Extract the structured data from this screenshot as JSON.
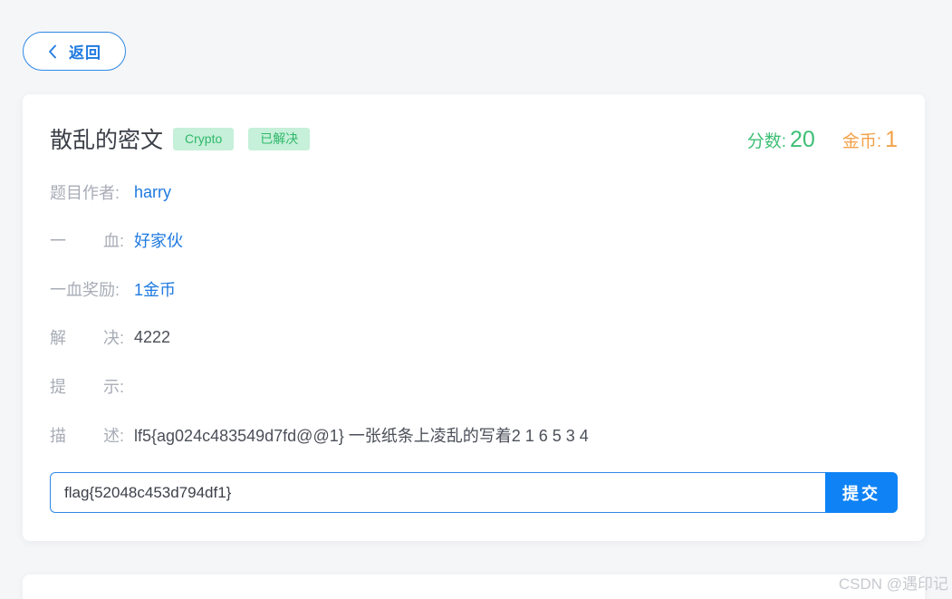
{
  "nav": {
    "back_label": "返回"
  },
  "challenge": {
    "title": "散乱的密文",
    "tags": [
      "Crypto",
      "已解决"
    ],
    "score_label": "分数:",
    "score_value": "20",
    "coin_label": "金币:",
    "coin_value": "1",
    "fields": {
      "author": {
        "label": "题目作者:",
        "value": "harry"
      },
      "first_blood": {
        "label_chars": [
          "一",
          "血:"
        ],
        "value": "好家伙"
      },
      "first_blood_reward": {
        "label": "一血奖励:",
        "value": "1金币"
      },
      "solves": {
        "label_chars": [
          "解",
          "决:"
        ],
        "value": "4222"
      },
      "hint": {
        "label_chars": [
          "提",
          "示:"
        ],
        "value": ""
      },
      "description": {
        "label_chars": [
          "描",
          "述:"
        ],
        "value": "lf5{ag024c483549d7fd@@1} 一张纸条上凌乱的写着2 1 6 5 3 4"
      }
    }
  },
  "submission": {
    "input_value": "flag{52048c453d794df1}",
    "submit_label": "提交"
  },
  "watermark": "CSDN @遇印记",
  "colors": {
    "accent": "#0f83f5",
    "score": "#3ebf75",
    "coin": "#f3a24a",
    "tag_bg": "#c6f0d9"
  },
  "icons": {
    "back": "chevron-left-icon"
  }
}
